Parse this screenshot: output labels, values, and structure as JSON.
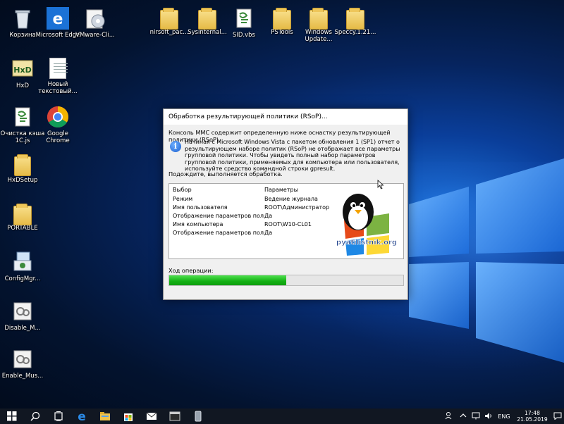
{
  "desktop": {
    "icons": [
      {
        "label": "Корзина",
        "icon": "recycle-bin-icon"
      },
      {
        "label": "Microsoft Edge",
        "icon": "edge-icon"
      },
      {
        "label": "VMware-Cli...",
        "icon": "vmware-installer-icon"
      },
      {
        "label": "nirsoft_pac...",
        "icon": "folder-icon"
      },
      {
        "label": "Sysinternal...",
        "icon": "folder-icon"
      },
      {
        "label": "SID.vbs",
        "icon": "script-icon"
      },
      {
        "label": "PSTools",
        "icon": "folder-icon"
      },
      {
        "label": "Windows Update...",
        "icon": "folder-icon"
      },
      {
        "label": "Speccy.1.21...",
        "icon": "folder-icon"
      },
      {
        "label": "HxD",
        "icon": "hxd-icon"
      },
      {
        "label": "Новый текстовый...",
        "icon": "text-document-icon"
      },
      {
        "label": "Очистка кэша 1С.js",
        "icon": "script-icon"
      },
      {
        "label": "Google Chrome",
        "icon": "chrome-icon"
      },
      {
        "label": "HxDSetup",
        "icon": "installer-icon"
      },
      {
        "label": "PORTABLE",
        "icon": "folder-icon"
      },
      {
        "label": "ConfigMgr...",
        "icon": "installer-icon"
      },
      {
        "label": "Disable_M...",
        "icon": "gear-file-icon"
      },
      {
        "label": "Enable_Mus...",
        "icon": "gear-file-icon"
      }
    ]
  },
  "dialog": {
    "title": "Обработка результирующей политики (RSoP)...",
    "description": "Консоль MMC содержит определенную ниже оснастку результирующей политики (RSoP).",
    "info_text": "Начиная с Microsoft Windows Vista с пакетом обновления 1 (SP1) отчет о результирующем наборе политик (RSoP) не отображает все параметры групповой политики. Чтобы увидеть полный набор параметров групповой политики, применяемых для компьютера или пользователя, используйте средство командной строки gpresult.",
    "wait_text": "Подождите, выполняется обработка.",
    "table": {
      "headers": [
        "Выбор",
        "Параметры"
      ],
      "rows": [
        [
          "Режим",
          "Ведение журнала"
        ],
        [
          "Имя пользователя",
          "ROOT\\Администратор"
        ],
        [
          "Отображение параметров полити...",
          "Да"
        ],
        [
          "Имя компьютера",
          "ROOT\\W10-CL01"
        ],
        [
          "Отображение параметров полити...",
          "Да"
        ]
      ]
    },
    "watermark": "pyatilistnik.org",
    "progress_label": "Ход операции:",
    "progress_fraction": 0.5
  },
  "taskbar": {
    "buttons": [
      "start-button",
      "search-button",
      "task-view-button",
      "edge-button",
      "explorer-button",
      "store-button",
      "mail-button",
      "terminal-button",
      "app-button"
    ],
    "tray": {
      "language": "ENG",
      "time": "17:48",
      "date": "21.05.2019"
    }
  },
  "colors": {
    "desktop_blue": "#0a3e9a",
    "progress_green": "#14b014",
    "taskbar": "#111722"
  }
}
